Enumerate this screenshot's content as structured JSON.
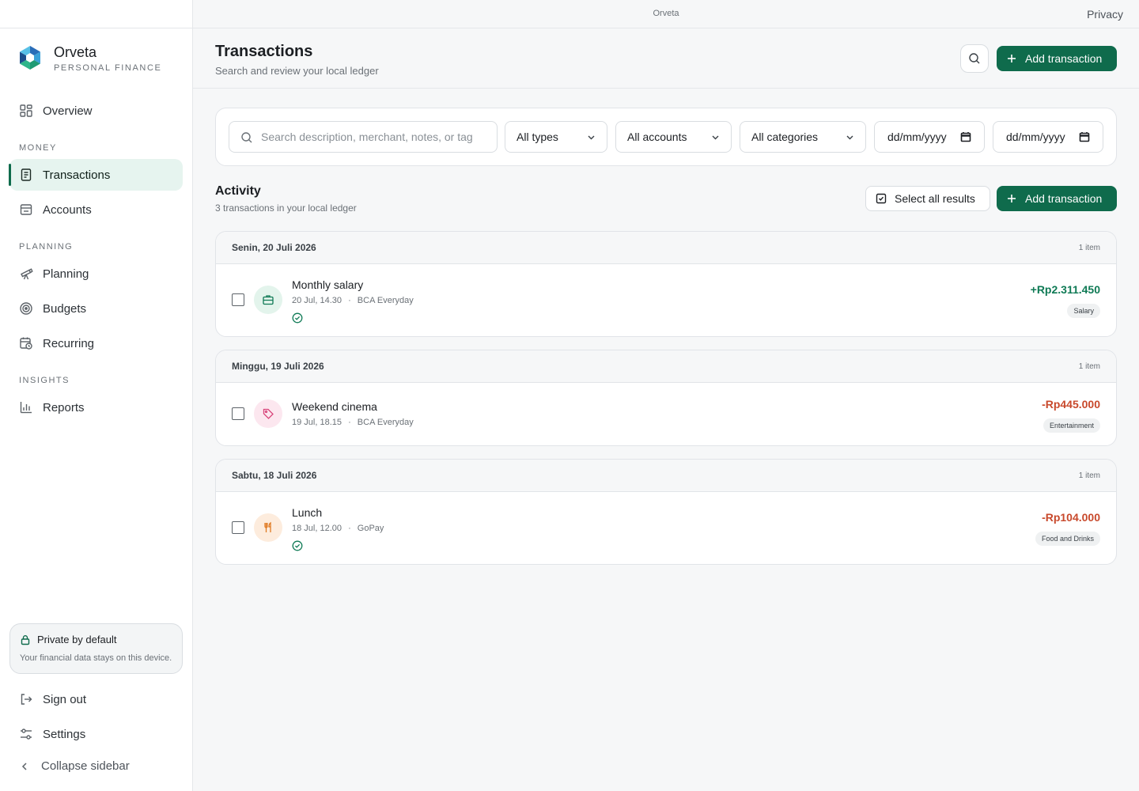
{
  "topbar": {
    "center": "Orveta",
    "right_link": "Privacy"
  },
  "brand": {
    "name": "Orveta",
    "subtitle": "PERSONAL FINANCE"
  },
  "sidebar": {
    "overview": "Overview",
    "sections": {
      "money": "MONEY",
      "planning": "PLANNING",
      "insights": "INSIGHTS"
    },
    "items": {
      "transactions": "Transactions",
      "accounts": "Accounts",
      "planning": "Planning",
      "budgets": "Budgets",
      "recurring": "Recurring",
      "reports": "Reports"
    },
    "active": "Transactions",
    "privacy": {
      "title": "Private by default",
      "text": "Your financial data stays on this device."
    },
    "sign_out": "Sign out",
    "settings": "Settings",
    "collapse": "Collapse sidebar"
  },
  "header": {
    "title": "Transactions",
    "subtitle": "Search and review your local ledger",
    "add_label": "Add transaction"
  },
  "filters": {
    "search_placeholder": "Search description, merchant, notes, or tag",
    "type": "All types",
    "account": "All accounts",
    "category": "All categories",
    "date_from": "dd/mm/yyyy",
    "date_to": "dd/mm/yyyy"
  },
  "activity": {
    "title": "Activity",
    "subtitle": "3 transactions in your local ledger",
    "select_all": "Select all results",
    "add_label": "Add transaction"
  },
  "groups": [
    {
      "date": "Senin, 20 Juli 2026",
      "count": "1 item",
      "tx": {
        "name": "Monthly salary",
        "time": "20 Jul, 14.30",
        "account": "BCA Everyday",
        "amount": "+Rp2.311.450",
        "category": "Salary",
        "icon": "briefcase-icon",
        "icon_color": "#0f7a55",
        "icon_bg": "#e3f4ec",
        "reconciled": true
      }
    },
    {
      "date": "Minggu, 19 Juli 2026",
      "count": "1 item",
      "tx": {
        "name": "Weekend cinema",
        "time": "19 Jul, 18.15",
        "account": "BCA Everyday",
        "amount": "-Rp445.000",
        "category": "Entertainment",
        "icon": "tag-icon",
        "icon_color": "#d8457a",
        "icon_bg": "#fce7ef",
        "reconciled": false
      }
    },
    {
      "date": "Sabtu, 18 Juli 2026",
      "count": "1 item",
      "tx": {
        "name": "Lunch",
        "time": "18 Jul, 12.00",
        "account": "GoPay",
        "amount": "-Rp104.000",
        "category": "Food and Drinks",
        "icon": "utensils-icon",
        "icon_color": "#e07a22",
        "icon_bg": "#fdecdd",
        "reconciled": true
      }
    }
  ],
  "meta_separator": "·",
  "colors": {
    "accent": "#0f6b4c",
    "positive": "#0f7a55",
    "negative": "#c8492c",
    "active_nav_bg": "#e6f4ef"
  }
}
